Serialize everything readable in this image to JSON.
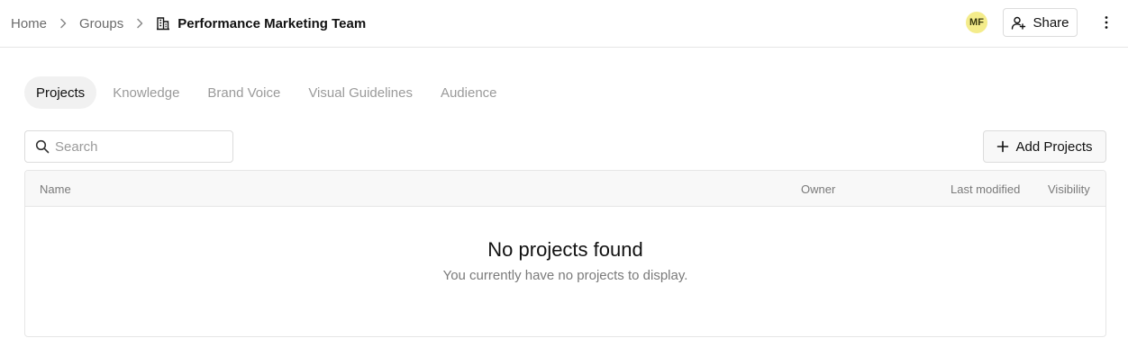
{
  "breadcrumb": {
    "home": "Home",
    "groups": "Groups",
    "current": "Performance Marketing Team"
  },
  "header": {
    "avatar_initials": "MF",
    "share_label": "Share"
  },
  "tabs": [
    {
      "label": "Projects",
      "active": true
    },
    {
      "label": "Knowledge",
      "active": false
    },
    {
      "label": "Brand Voice",
      "active": false
    },
    {
      "label": "Visual Guidelines",
      "active": false
    },
    {
      "label": "Audience",
      "active": false
    }
  ],
  "search": {
    "placeholder": "Search",
    "value": ""
  },
  "add_button": {
    "label": "Add Projects"
  },
  "table": {
    "columns": {
      "name": "Name",
      "owner": "Owner",
      "last_modified": "Last modified",
      "visibility": "Visibility"
    },
    "empty_title": "No projects found",
    "empty_subtitle": "You currently have no projects to display."
  },
  "colors": {
    "avatar_bg": "#f4ec8b",
    "active_tab_bg": "#f1f1f1",
    "border": "#e6e6e6"
  },
  "icons": [
    "chevron-right-icon",
    "building-icon",
    "user-plus-icon",
    "more-vertical-icon",
    "search-icon",
    "plus-icon"
  ]
}
